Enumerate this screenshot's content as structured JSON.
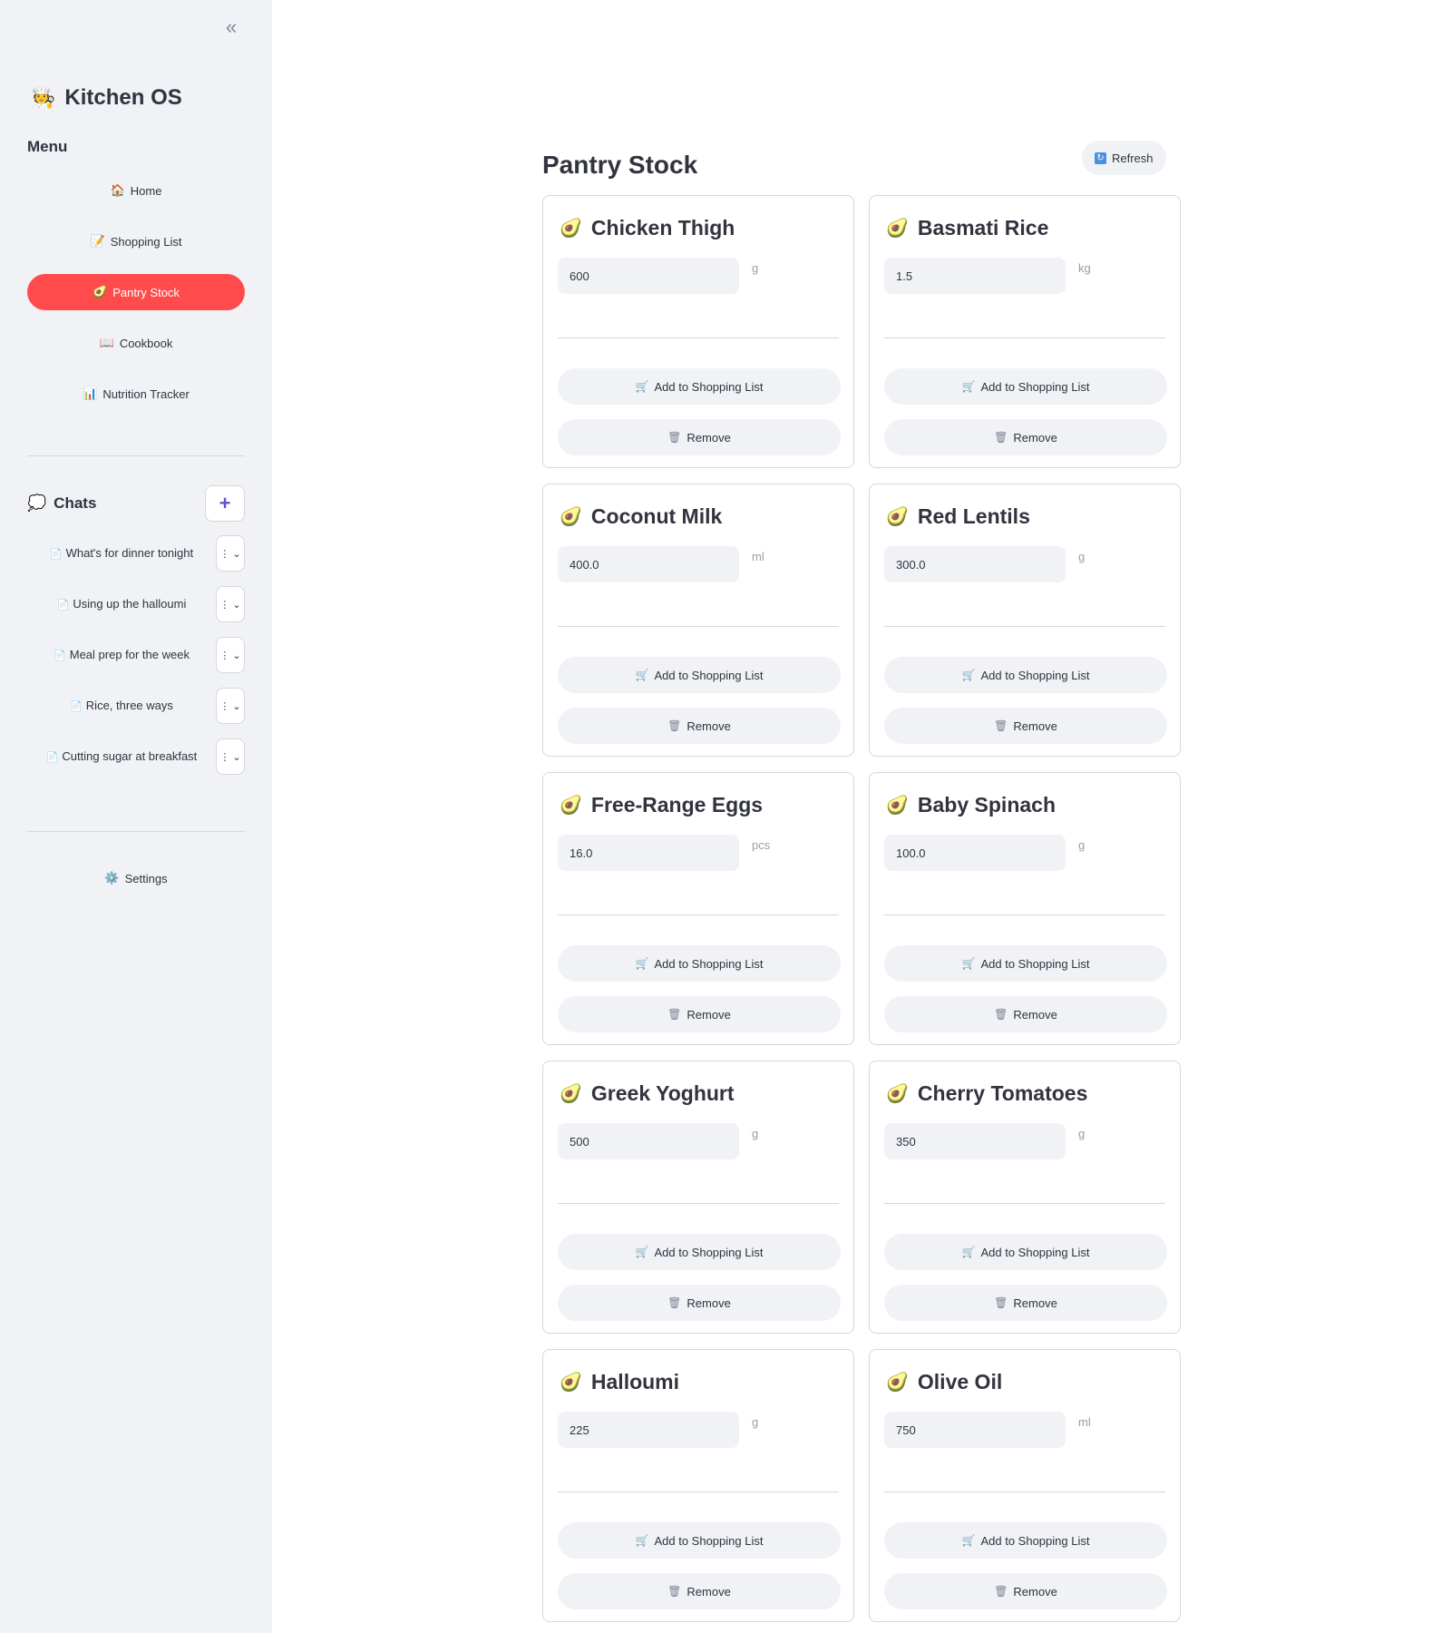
{
  "sidebar": {
    "brand_emoji": "🧑‍🍳",
    "brand_title": "Kitchen OS",
    "menu_heading": "Menu",
    "nav": [
      {
        "icon": "🏠",
        "label": "Home",
        "active": false
      },
      {
        "icon": "📝",
        "label": "Shopping List",
        "active": false
      },
      {
        "icon": "🥑",
        "label": "Pantry Stock",
        "active": true
      },
      {
        "icon": "📖",
        "label": "Cookbook",
        "active": false
      },
      {
        "icon": "📊",
        "label": "Nutrition Tracker",
        "active": false
      }
    ],
    "chats_icon": "💭",
    "chats_title": "Chats",
    "new_chat_label": "+",
    "chats": [
      {
        "icon": "📄",
        "label": "What's for dinner tonight"
      },
      {
        "icon": "📄",
        "label": "Using up the halloumi"
      },
      {
        "icon": "📄",
        "label": "Meal prep for the week"
      },
      {
        "icon": "📄",
        "label": "Rice, three ways"
      },
      {
        "icon": "📄",
        "label": "Cutting sugar at breakfast"
      }
    ],
    "chat_menu_glyph": "⋮",
    "chat_menu_chevron": "⌄",
    "settings_icon": "⚙️",
    "settings_label": "Settings",
    "collapse_glyph": "«"
  },
  "main": {
    "title": "Pantry Stock",
    "refresh_icon": "↻",
    "refresh_label": "Refresh",
    "item_icon": "🥑",
    "add_icon": "🛒",
    "add_label": "Add to Shopping List",
    "remove_icon": "🗑",
    "remove_label": "Remove",
    "items": [
      {
        "name": "Chicken Thigh",
        "qty": "600",
        "unit": "g"
      },
      {
        "name": "Basmati Rice",
        "qty": "1.5",
        "unit": "kg"
      },
      {
        "name": "Coconut Milk",
        "qty": "400.0",
        "unit": "ml"
      },
      {
        "name": "Red Lentils",
        "qty": "300.0",
        "unit": "g"
      },
      {
        "name": "Free-Range Eggs",
        "qty": "16.0",
        "unit": "pcs"
      },
      {
        "name": "Baby Spinach",
        "qty": "100.0",
        "unit": "g"
      },
      {
        "name": "Greek Yoghurt",
        "qty": "500",
        "unit": "g"
      },
      {
        "name": "Cherry Tomatoes",
        "qty": "350",
        "unit": "g"
      },
      {
        "name": "Halloumi",
        "qty": "225",
        "unit": "g"
      },
      {
        "name": "Olive Oil",
        "qty": "750",
        "unit": "ml"
      }
    ]
  },
  "colors": {
    "accent": "#ff4b4b",
    "sidebar_bg": "#f0f2f6",
    "plus": "#6c4fc8"
  }
}
